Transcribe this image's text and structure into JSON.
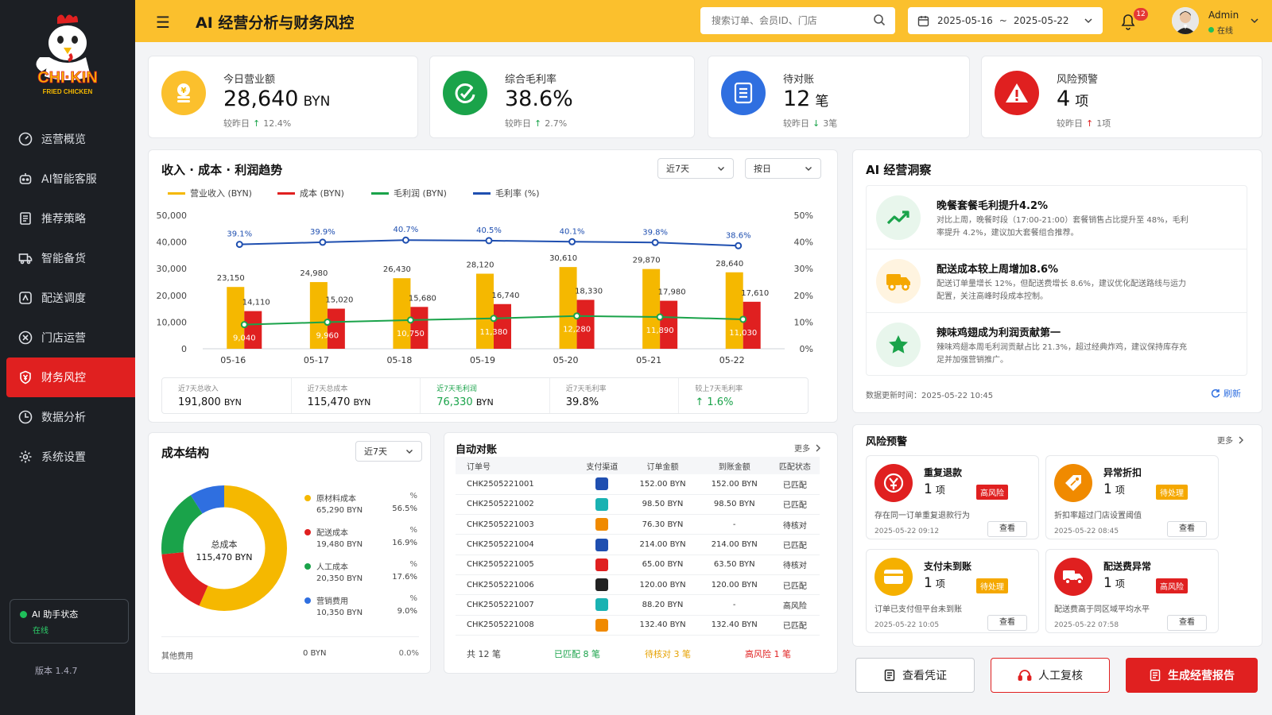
{
  "brand": {
    "name": "CHI·KIN",
    "sub": "FRIED CHICKEN"
  },
  "sidebar": {
    "items": [
      {
        "label": "运营概览",
        "icon": "dashboard-icon"
      },
      {
        "label": "AI智能客服",
        "icon": "robot-icon"
      },
      {
        "label": "推荐策略",
        "icon": "document-icon"
      },
      {
        "label": "智能备货",
        "icon": "truck-box-icon"
      },
      {
        "label": "配送调度",
        "icon": "dispatch-icon"
      },
      {
        "label": "门店运营",
        "icon": "store-icon"
      },
      {
        "label": "财务风控",
        "icon": "shield-yen-icon",
        "active": true
      },
      {
        "label": "数据分析",
        "icon": "clock-chart-icon"
      },
      {
        "label": "系统设置",
        "icon": "gear-icon"
      }
    ],
    "ai_status_title": "AI 助手状态",
    "ai_status_value": "在线",
    "version": "版本 1.4.7"
  },
  "header": {
    "title": "AI 经营分析与财务风控",
    "search_placeholder": "搜索订单、会员ID、门店",
    "date_start": "2025-05-16",
    "date_sep": "~",
    "date_end": "2025-05-22",
    "notifications": "12",
    "user_name": "Admin",
    "user_status": "在线"
  },
  "kpis": [
    {
      "label": "今日营业额",
      "value": "28,640",
      "unit": "BYN",
      "cmp_label": "较昨日",
      "cmp_value": "12.4%",
      "dir": "up",
      "color": "#f5b800"
    },
    {
      "label": "综合毛利率",
      "value": "38.6%",
      "unit": "",
      "cmp_label": "较昨日",
      "cmp_value": "2.7%",
      "dir": "up",
      "color": "#1aa34a"
    },
    {
      "label": "待对账",
      "value": "12",
      "unit": "笔",
      "cmp_label": "较昨日",
      "cmp_value": "3笔",
      "dir": "down",
      "color": "#2f6fe0"
    },
    {
      "label": "风险预警",
      "value": "4",
      "unit": "项",
      "cmp_label": "较昨日",
      "cmp_value": "1项",
      "dir": "up",
      "color": "#e02020"
    }
  ],
  "trend": {
    "title": "收入 · 成本 · 利润趋势",
    "range_select": "近7天",
    "granularity_select": "按日",
    "summary": [
      {
        "label": "近7天总收入",
        "value": "191,800",
        "unit": "BYN"
      },
      {
        "label": "近7天总成本",
        "value": "115,470",
        "unit": "BYN"
      },
      {
        "label": "近7天毛利润",
        "value": "76,330",
        "unit": "BYN"
      },
      {
        "label": "近7天毛利率",
        "value": "39.8%",
        "unit": ""
      },
      {
        "label": "较上7天毛利率",
        "value": "↑ 1.6%",
        "unit": ""
      }
    ]
  },
  "chart_data": {
    "type": "bar",
    "categories": [
      "05-16",
      "05-17",
      "05-18",
      "05-19",
      "05-20",
      "05-21",
      "05-22"
    ],
    "series": [
      {
        "name": "营业收入 (BYN)",
        "type": "bar",
        "color": "#f5b800",
        "values": [
          23150,
          24980,
          26430,
          28120,
          30610,
          29870,
          28640
        ]
      },
      {
        "name": "成本 (BYN)",
        "type": "bar",
        "color": "#e02020",
        "values": [
          14110,
          15020,
          15680,
          16740,
          18330,
          17980,
          17610
        ]
      },
      {
        "name": "毛利润 (BYN)",
        "type": "line",
        "color": "#1aa34a",
        "values": [
          9040,
          9960,
          10750,
          11380,
          12280,
          11890,
          11030
        ]
      },
      {
        "name": "毛利率 (%)",
        "type": "line",
        "axis": "right",
        "color": "#1f4fb0",
        "values": [
          39.1,
          39.9,
          40.7,
          40.5,
          40.1,
          39.8,
          38.6
        ]
      }
    ],
    "ylim": [
      0,
      50000
    ],
    "yticks": [
      "0",
      "10,000",
      "20,000",
      "30,000",
      "40,000",
      "50,000"
    ],
    "y2lim": [
      0,
      50
    ],
    "y2ticks": [
      "0%",
      "10%",
      "20%",
      "30%",
      "40%",
      "50%"
    ],
    "bar_labels": {
      "revenue": [
        "23,150",
        "24,980",
        "26,430",
        "28,120",
        "30,610",
        "29,870",
        "28,640"
      ],
      "cost": [
        "14,110",
        "15,020",
        "15,680",
        "16,740",
        "18,330",
        "17,980",
        "17,610"
      ],
      "profit": [
        "9,040",
        "9,960",
        "10,750",
        "11,380",
        "12,280",
        "11,890",
        "11,030"
      ],
      "margin": [
        "39.1%",
        "39.9%",
        "40.7%",
        "40.5%",
        "40.1%",
        "39.8%",
        "38.6%"
      ]
    },
    "legend_placement": "top-left",
    "grid": false
  },
  "insights": {
    "title": "AI 经营洞察",
    "items": [
      {
        "title": "晚餐套餐毛利提升4.2%",
        "desc": "对比上周，晚餐时段（17:00-21:00）套餐销售占比提升至 48%，毛利率提升 4.2%，建议加大套餐组合推荐。"
      },
      {
        "title": "配送成本较上周增加8.6%",
        "desc": "配送订单量增长 12%，但配送费增长 8.6%，建议优化配送路线与运力配置，关注高峰时段成本控制。"
      },
      {
        "title": "辣味鸡翅成为利润贡献第一",
        "desc": "辣味鸡翅本周毛利润贡献占比 21.3%，超过经典炸鸡，建议保持库存充足并加强营销推广。"
      }
    ],
    "updated": "数据更新时间：2025-05-22 10:45",
    "refresh": "刷新"
  },
  "cost": {
    "title": "成本结构",
    "range_select": "近7天",
    "center_label": "总成本",
    "center_value": "115,470 BYN",
    "items": [
      {
        "name": "原材料成本",
        "amount": "65,290 BYN",
        "pct": "56.5%",
        "value": 56.5,
        "color": "#f5b800"
      },
      {
        "name": "配送成本",
        "amount": "19,480 BYN",
        "pct": "16.9%",
        "value": 16.9,
        "color": "#e02020"
      },
      {
        "name": "人工成本",
        "amount": "20,350 BYN",
        "pct": "17.6%",
        "value": 17.6,
        "color": "#1aa34a"
      },
      {
        "name": "营销费用",
        "amount": "10,350 BYN",
        "pct": "9.0%",
        "value": 9.0,
        "color": "#2f6fe0"
      }
    ],
    "pct_unit": "%",
    "other_name": "其他费用",
    "other_amount": "0 BYN",
    "other_pct": "0.0%"
  },
  "recon": {
    "title": "自动对账",
    "more": "更多",
    "headers": [
      "订单号",
      "支付渠道",
      "订单金额",
      "到账金额",
      "匹配状态"
    ],
    "rows": [
      {
        "id": "CHK2505221001",
        "pay": "bank-card-icon",
        "color": "#1f4fb0",
        "amount": "152.00 BYN",
        "received": "152.00 BYN",
        "status": "已匹配",
        "cls": "st-ok"
      },
      {
        "id": "CHK2505221002",
        "pay": "wallet-icon",
        "color": "#1ab2b2",
        "amount": "98.50 BYN",
        "received": "98.50 BYN",
        "status": "已匹配",
        "cls": "st-ok"
      },
      {
        "id": "CHK2505221003",
        "pay": "orange-pay-icon",
        "color": "#f08a00",
        "amount": "76.30 BYN",
        "received": "-",
        "status": "待核对",
        "cls": "st-wait"
      },
      {
        "id": "CHK2505221004",
        "pay": "paypal-icon",
        "color": "#1f4fb0",
        "amount": "214.00 BYN",
        "received": "214.00 BYN",
        "status": "已匹配",
        "cls": "st-ok"
      },
      {
        "id": "CHK2505221005",
        "pay": "red-pay-icon",
        "color": "#e02020",
        "amount": "65.00 BYN",
        "received": "63.50 BYN",
        "status": "待核对",
        "cls": "st-wait"
      },
      {
        "id": "CHK2505221006",
        "pay": "cash-icon",
        "color": "#222222",
        "amount": "120.00 BYN",
        "received": "120.00 BYN",
        "status": "已匹配",
        "cls": "st-ok"
      },
      {
        "id": "CHK2505221007",
        "pay": "wallet-icon",
        "color": "#1ab2b2",
        "amount": "88.20 BYN",
        "received": "-",
        "status": "高风险",
        "cls": "st-risk"
      },
      {
        "id": "CHK2505221008",
        "pay": "orange-pay-icon",
        "color": "#f08a00",
        "amount": "132.40 BYN",
        "received": "132.40 BYN",
        "status": "已匹配",
        "cls": "st-ok"
      }
    ],
    "footer_total": "共 12 笔",
    "footer_ok": "已匹配 8 笔",
    "footer_wait": "待核对 3 笔",
    "footer_risk": "高风险 1 笔"
  },
  "risk": {
    "title": "风险预警",
    "more": "更多",
    "items": [
      {
        "title": "重复退款",
        "count": "1",
        "unit": "项",
        "badge": "高风险",
        "badge_color": "#e02020",
        "desc": "存在同一订单重复退款行为",
        "time": "2025-05-22 09:12",
        "view": "查看",
        "color": "#e02020",
        "icon": "yen-icon"
      },
      {
        "title": "异常折扣",
        "count": "1",
        "unit": "项",
        "badge": "待处理",
        "badge_color": "#f5a800",
        "desc": "折扣率超过门店设置阈值",
        "time": "2025-05-22 08:45",
        "view": "查看",
        "color": "#f08a00",
        "icon": "tag-icon"
      },
      {
        "title": "支付未到账",
        "count": "1",
        "unit": "项",
        "badge": "待处理",
        "badge_color": "#f5a800",
        "desc": "订单已支付但平台未到账",
        "time": "2025-05-22 10:05",
        "view": "查看",
        "color": "#f5b000",
        "icon": "card-icon"
      },
      {
        "title": "配送费异常",
        "count": "1",
        "unit": "项",
        "badge": "高风险",
        "badge_color": "#e02020",
        "desc": "配送费高于同区域平均水平",
        "time": "2025-05-22 07:58",
        "view": "查看",
        "color": "#e02020",
        "icon": "truck-icon"
      }
    ]
  },
  "actions": {
    "voucher": "查看凭证",
    "review": "人工复核",
    "report": "生成经营报告"
  }
}
